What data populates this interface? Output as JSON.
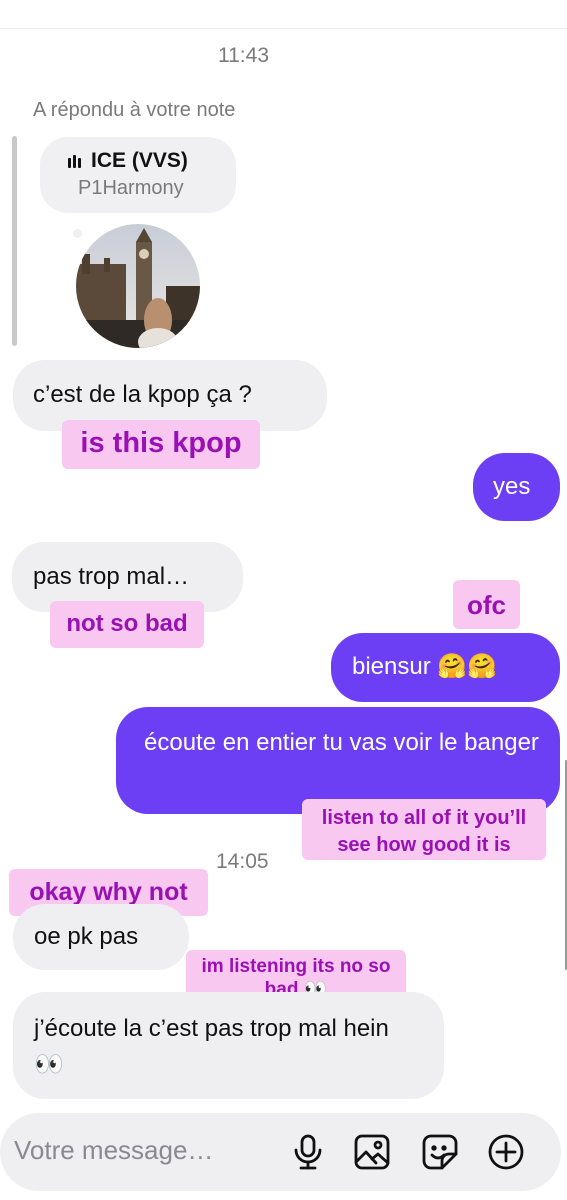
{
  "timestamps": [
    "11:43",
    "14:05"
  ],
  "reply_context": "A répondu à votre note",
  "note": {
    "title": "ICE (VVS)",
    "artist": "P1Harmony"
  },
  "messages": [
    {
      "text": "c’est de la kpop ça ?"
    },
    {
      "text": "yes"
    },
    {
      "text": "pas trop mal…"
    },
    {
      "text": "biensur 🤗🤗"
    },
    {
      "text": "écoute en entier tu vas voir le banger"
    },
    {
      "text": "oe pk pas"
    },
    {
      "text": "j’écoute la c’est pas trop mal hein 👀"
    }
  ],
  "translations": {
    "kpop": "is this kpop",
    "notbad": "not so bad",
    "ofc": "ofc",
    "listen": "listen to all of it you’ll see how good it is",
    "okay": "okay why not",
    "listening": "im listening its no so bad 👀"
  },
  "composer": {
    "placeholder": "Votre message…"
  },
  "icons": [
    "music-bars-icon",
    "microphone-icon",
    "gallery-icon",
    "sticker-icon",
    "plus-circle-icon"
  ],
  "colors": {
    "outgoing": "#6c3ff5",
    "incoming": "#efeff1",
    "annotation_bg": "#f8c8f0",
    "annotation_text": "#9a10b4"
  }
}
